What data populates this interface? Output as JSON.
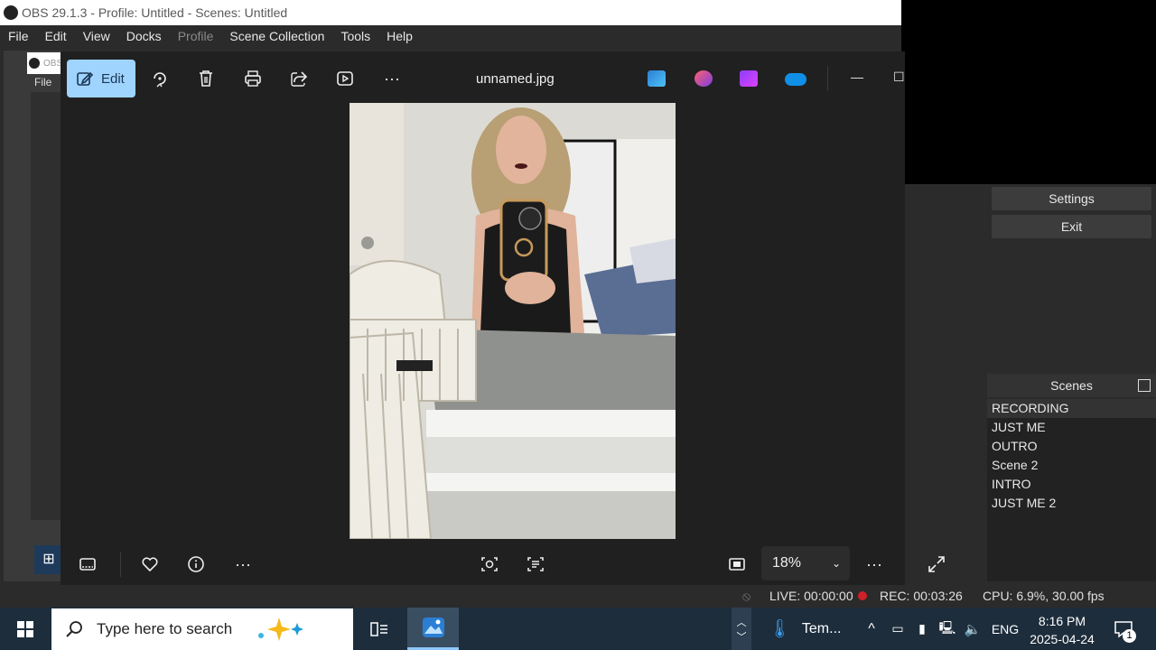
{
  "obs": {
    "title": "OBS 29.1.3 - Profile: Untitled - Scenes: Untitled",
    "menu": [
      "File",
      "Edit",
      "View",
      "Docks",
      "Profile",
      "Scene Collection",
      "Tools",
      "Help"
    ],
    "inner_title": "OBS",
    "inner_file": "File",
    "buttons": {
      "settings": "Settings",
      "exit": "Exit"
    },
    "scenes_title": "Scenes",
    "scenes": [
      "RECORDING",
      "JUST ME",
      "OUTRO",
      "Scene 2",
      "INTRO",
      "JUST ME 2"
    ],
    "status": {
      "live": "LIVE: 00:00:00",
      "rec": "REC: 00:03:26",
      "cpu": "CPU: 6.9%, 30.00 fps"
    }
  },
  "photos": {
    "edit_label": "Edit",
    "file_name": "unnamed.jpg",
    "zoom": "18%",
    "toolbar_icons": [
      "edit-icon",
      "rotate-icon",
      "delete-icon",
      "print-icon",
      "share-icon",
      "slideshow-icon",
      "more-icon"
    ],
    "app_icons": [
      "clipchamp-icon",
      "copilot-designer-icon",
      "video-editor-icon",
      "onedrive-icon"
    ]
  },
  "taskbar": {
    "search_placeholder": "Type here to search",
    "weather": "Tem...",
    "language": "ENG",
    "time": "8:16 PM",
    "date": "2025-04-24",
    "notification_count": "1"
  },
  "colors": {
    "edit_accent": "#9fd4ff",
    "rec_dot": "#d0202a",
    "taskbar_bg": "#1d2d3c"
  }
}
